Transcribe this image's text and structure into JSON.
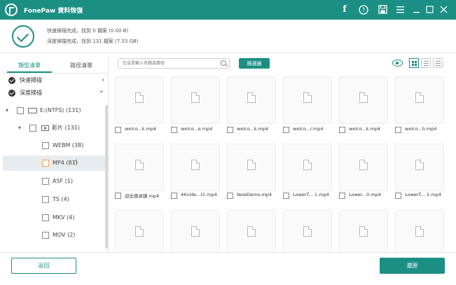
{
  "app": {
    "title": "FonePaw 資料恢復",
    "accent_color": "#1c8f84",
    "titlebar_icons": [
      "facebook-icon",
      "feedback-icon",
      "save-icon",
      "menu-icon",
      "minimize-icon",
      "maximize-icon",
      "close-icon"
    ]
  },
  "scan_status": {
    "quick_scan_line": "快速掃描完成，找到 0 檔案 (0.00 B)",
    "deep_scan_line": "深度掃描完成，找到 131 檔案 (7.53 GB)"
  },
  "sidebar": {
    "tabs": [
      {
        "label": "類型清單",
        "active": true
      },
      {
        "label": "路徑清單",
        "active": false
      }
    ],
    "scan_modes": [
      {
        "label": "快速掃描",
        "chevron": "›"
      },
      {
        "label": "深度掃描",
        "chevron": "⌄"
      }
    ],
    "tree": {
      "drive": "E:(NTFS) (131)",
      "video_folder": "影片 (131)",
      "formats": [
        {
          "label": "WEBM (38)",
          "selected": false
        },
        {
          "label": "MP4 (81)",
          "selected": true
        },
        {
          "label": "ASF (1)",
          "selected": false
        },
        {
          "label": "TS (4)",
          "selected": false
        },
        {
          "label": "MKV (4)",
          "selected": false
        },
        {
          "label": "MOV (2)",
          "selected": false
        }
      ]
    }
  },
  "toolbar": {
    "search_placeholder": "在這里輸入名稱或路徑",
    "filter_label": "篩選器",
    "icons": [
      "eye-icon",
      "grid-view-icon",
      "list-view-icon",
      "detail-view-icon"
    ],
    "active_view": "grid"
  },
  "files": {
    "row1": [
      "welco...k.mp4",
      "welco...e.mp4",
      "welco...k.mp4",
      "welco...r.mp4",
      "welco...k.mp4",
      "welco...h.mp4"
    ],
    "row2": [
      "迎出徳卓鎮.mp4",
      "4Kvide...t1.mp4",
      "NewDemo.mp4",
      "LowerT... 1.mp4",
      "Lower...0.mp4",
      "LowerT... 2.mp4"
    ]
  },
  "footer": {
    "back_label": "返回",
    "recover_label": "還原"
  }
}
